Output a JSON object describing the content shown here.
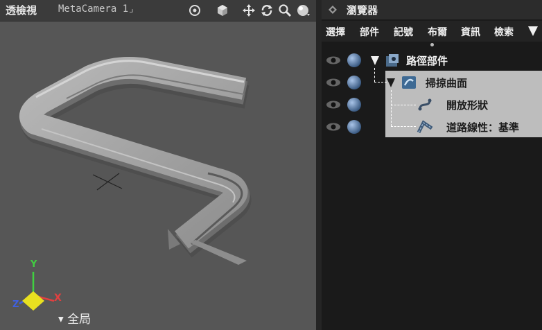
{
  "viewport": {
    "title": "透檢視",
    "camera": "MetaCamera 1",
    "camera_suffix": "⌟",
    "bottom_label": "全局",
    "axis_labels": {
      "x": "X",
      "y": "Y",
      "z": "Z"
    },
    "header_icons": [
      "target-icon",
      "cube-icon",
      "move-icon",
      "rotate-icon",
      "zoom-icon",
      "sphere-icon"
    ]
  },
  "browser": {
    "title": "瀏覽器",
    "menu": [
      "選擇",
      "部件",
      "記號",
      "布爾",
      "資訊",
      "檢索"
    ],
    "tree": [
      {
        "label": "路徑部件",
        "level": 0,
        "icon": "part-icon",
        "expanded": true
      },
      {
        "label": "掃掠曲面",
        "level": 1,
        "icon": "sweep-surface-icon",
        "expanded": true,
        "selected": true
      },
      {
        "label": "開放形狀",
        "level": 2,
        "icon": "open-shape-icon"
      },
      {
        "label": "道路線性：基準",
        "level": 2,
        "icon": "road-alignment-icon"
      }
    ]
  },
  "colors": {
    "viewport_bg": "#565656",
    "browser_bg": "#1a1a1a",
    "selection": "#bdbdbd",
    "axis_x": "#e04040",
    "axis_y": "#40d040",
    "axis_z": "#4060e0"
  }
}
